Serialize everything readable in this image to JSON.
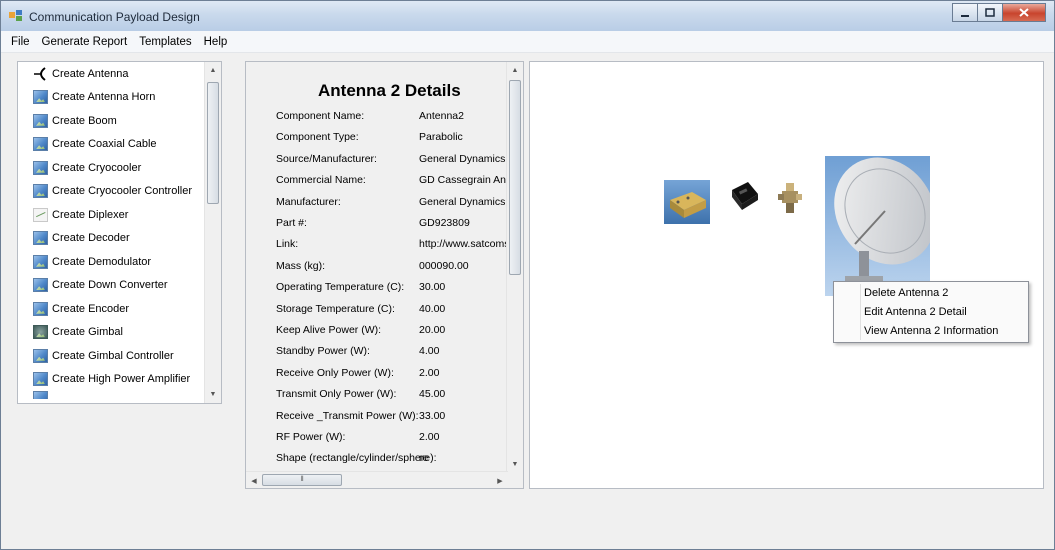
{
  "window": {
    "title": "Communication Payload Design",
    "controls": [
      "minimize",
      "maximize",
      "close"
    ]
  },
  "menu": [
    "File",
    "Generate Report",
    "Templates",
    "Help"
  ],
  "component_list": [
    {
      "label": "Create Antenna",
      "icon": "antenna-icon"
    },
    {
      "label": "Create Antenna Horn",
      "icon": "image-icon"
    },
    {
      "label": "Create Boom",
      "icon": "image-icon"
    },
    {
      "label": "Create Coaxial Cable",
      "icon": "image-icon"
    },
    {
      "label": "Create Cryocooler",
      "icon": "image-icon"
    },
    {
      "label": "Create Cryocooler Controller",
      "icon": "image-icon"
    },
    {
      "label": "Create Diplexer",
      "icon": "diplexer-icon"
    },
    {
      "label": "Create Decoder",
      "icon": "image-icon"
    },
    {
      "label": "Create Demodulator",
      "icon": "image-icon"
    },
    {
      "label": "Create Down Converter",
      "icon": "image-icon"
    },
    {
      "label": "Create Encoder",
      "icon": "image-icon"
    },
    {
      "label": "Create Gimbal",
      "icon": "gimbal-icon"
    },
    {
      "label": "Create Gimbal Controller",
      "icon": "image-icon"
    },
    {
      "label": "Create High Power Amplifier",
      "icon": "image-icon"
    }
  ],
  "details": {
    "title": "Antenna 2 Details",
    "rows": [
      {
        "label": "Component Name:",
        "value": "Antenna2"
      },
      {
        "label": "Component Type:",
        "value": "Parabolic"
      },
      {
        "label": "Source/Manufacturer:",
        "value": "General Dynamics"
      },
      {
        "label": "Commercial Name:",
        "value": "GD Cassegrain Anten"
      },
      {
        "label": "Manufacturer:",
        "value": "General Dynamics"
      },
      {
        "label": "Part #:",
        "value": "GD923809"
      },
      {
        "label": "Link:",
        "value": "http://www.satcoms.c"
      },
      {
        "label": "Mass (kg):",
        "value": "000090.00"
      },
      {
        "label": "Operating Temperature (C):",
        "value": "30.00"
      },
      {
        "label": "Storage Temperature (C):",
        "value": "40.00"
      },
      {
        "label": "Keep Alive Power (W):",
        "value": "20.00"
      },
      {
        "label": "Standby Power (W):",
        "value": "4.00"
      },
      {
        "label": "Receive Only Power (W):",
        "value": "2.00"
      },
      {
        "label": "Transmit Only Power (W):",
        "value": "45.00"
      },
      {
        "label": "Receive _Transmit Power (W):",
        "value": "33.00"
      },
      {
        "label": "RF Power (W):",
        "value": "2.00"
      },
      {
        "label": "Shape (rectangle/cylinder/sphere):",
        "value": "re"
      }
    ]
  },
  "canvas_components": [
    "gold-box-component-icon",
    "black-module-component-icon",
    "connector-component-icon",
    "parabolic-dish-antenna-icon"
  ],
  "context_menu": [
    "Delete Antenna 2",
    "Edit Antenna 2 Detail",
    "View Antenna 2 Information"
  ],
  "colors": {
    "titlebar": "#c9d9ec",
    "close_button": "#c8442d",
    "background": "#f0f0f0"
  }
}
